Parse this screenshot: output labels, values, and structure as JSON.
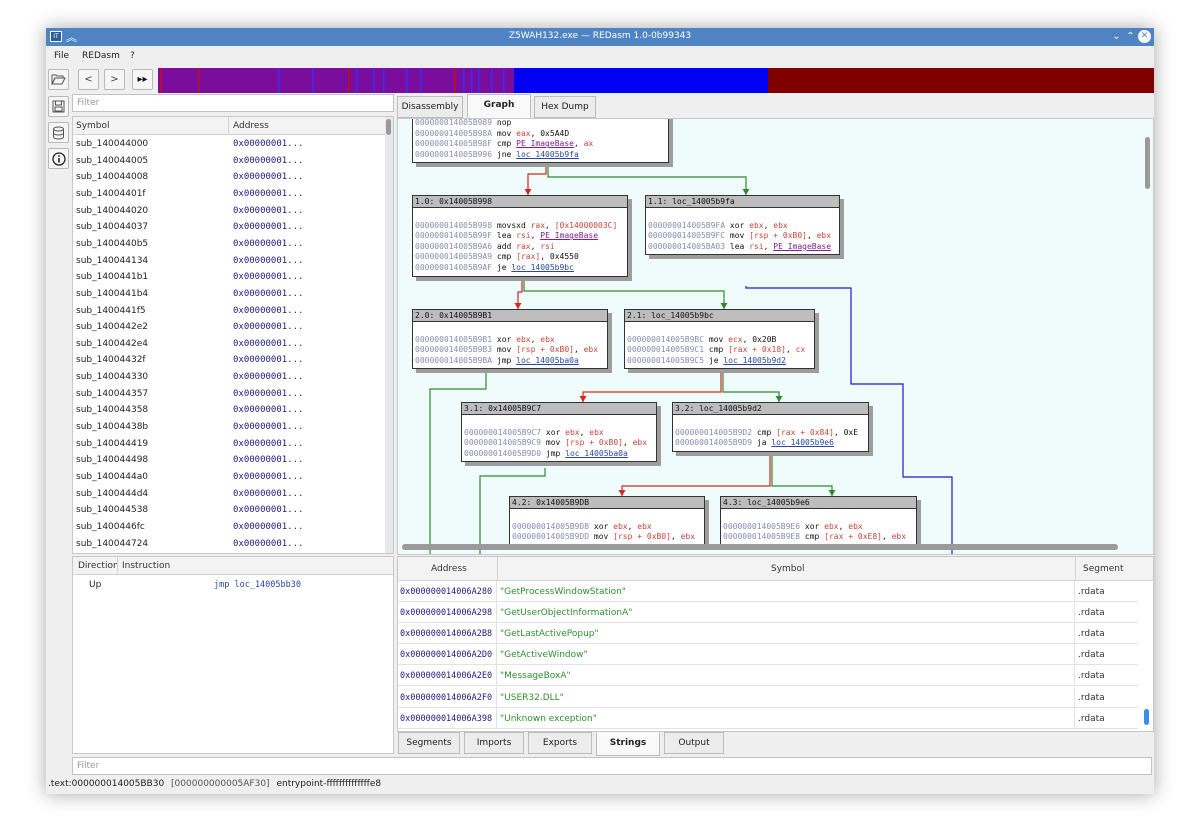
{
  "window": {
    "title": "Z5WAH132.exe — REDasm 1.0-0b99343",
    "app_icon": "IT"
  },
  "menu": [
    "File",
    "REDasm",
    "?"
  ],
  "icons": {
    "open": "folder-open-icon",
    "back": "back-icon",
    "forward": "forward-icon",
    "goto": "fast-forward-icon",
    "save": "save-icon",
    "database": "database-icon",
    "info": "info-icon"
  },
  "colors": {
    "titlebar": "#4f84c4",
    "nav_purple": "#7a0d9c",
    "nav_blue": "#0000f5",
    "nav_darkred": "#800000",
    "edge_true": "#2e8a2e",
    "edge_false": "#d0281f",
    "edge_jump": "#1919cc",
    "graph_bg": "#f0fbfb"
  },
  "symbols": {
    "filter_placeholder": "Filter",
    "columns": [
      "Symbol",
      "Address"
    ],
    "rows": [
      {
        "name": "sub_140044000",
        "address": "0x00000001..."
      },
      {
        "name": "sub_140044005",
        "address": "0x00000001..."
      },
      {
        "name": "sub_140044008",
        "address": "0x00000001..."
      },
      {
        "name": "sub_14004401f",
        "address": "0x00000001..."
      },
      {
        "name": "sub_140044020",
        "address": "0x00000001..."
      },
      {
        "name": "sub_140044037",
        "address": "0x00000001..."
      },
      {
        "name": "sub_1400440b5",
        "address": "0x00000001..."
      },
      {
        "name": "sub_140044134",
        "address": "0x00000001..."
      },
      {
        "name": "sub_1400441b1",
        "address": "0x00000001..."
      },
      {
        "name": "sub_1400441b4",
        "address": "0x00000001..."
      },
      {
        "name": "sub_1400441f5",
        "address": "0x00000001..."
      },
      {
        "name": "sub_1400442e2",
        "address": "0x00000001..."
      },
      {
        "name": "sub_1400442e4",
        "address": "0x00000001..."
      },
      {
        "name": "sub_14004432f",
        "address": "0x00000001..."
      },
      {
        "name": "sub_140044330",
        "address": "0x00000001..."
      },
      {
        "name": "sub_140044357",
        "address": "0x00000001..."
      },
      {
        "name": "sub_140044358",
        "address": "0x00000001..."
      },
      {
        "name": "sub_14004438b",
        "address": "0x00000001..."
      },
      {
        "name": "sub_140044419",
        "address": "0x00000001..."
      },
      {
        "name": "sub_140044498",
        "address": "0x00000001..."
      },
      {
        "name": "sub_1400444a0",
        "address": "0x00000001..."
      },
      {
        "name": "sub_1400444d4",
        "address": "0x00000001..."
      },
      {
        "name": "sub_140044538",
        "address": "0x00000001..."
      },
      {
        "name": "sub_1400446fc",
        "address": "0x00000001..."
      },
      {
        "name": "sub_140044724",
        "address": "0x00000001..."
      }
    ]
  },
  "tabs": {
    "top": [
      "Disassembly",
      "Graph",
      "Hex Dump"
    ],
    "top_active": "Graph",
    "bottom": [
      "Segments",
      "Imports",
      "Exports",
      "Strings",
      "Output"
    ],
    "bottom_active": "Strings"
  },
  "graph": {
    "nodes": [
      {
        "id": "n0",
        "title": "",
        "lines": [
          [
            [
              "ad",
              "000000014005B989"
            ],
            [
              "mn",
              " nop"
            ]
          ],
          [
            [
              "ad",
              "000000014005B98A"
            ],
            [
              "mn",
              " mov "
            ],
            [
              "rg",
              "eax"
            ],
            [
              "mn",
              ", 0x5A4D"
            ]
          ],
          [
            [
              "ad",
              "000000014005B98F"
            ],
            [
              "mn",
              " cmp "
            ],
            [
              "lk",
              "PE_ImageBase"
            ],
            [
              "mn",
              ", "
            ],
            [
              "rg",
              "ax"
            ]
          ],
          [
            [
              "ad",
              "000000014005B996"
            ],
            [
              "mn",
              " jne "
            ],
            [
              "lb",
              "loc_14005b9fa"
            ]
          ]
        ]
      },
      {
        "id": "n1",
        "title": "1.0: 0x14005B998",
        "lines": [
          [],
          [
            [
              "ad",
              "000000014005B998"
            ],
            [
              "mn",
              " movsxd "
            ],
            [
              "rg",
              "rax"
            ],
            [
              "mn",
              ", "
            ],
            [
              "rg",
              "[0x14000003C]"
            ]
          ],
          [
            [
              "ad",
              "000000014005B99F"
            ],
            [
              "mn",
              " lea "
            ],
            [
              "rg",
              "rsi"
            ],
            [
              "mn",
              ", "
            ],
            [
              "lk",
              "PE_ImageBase"
            ]
          ],
          [
            [
              "ad",
              "000000014005B9A6"
            ],
            [
              "mn",
              " add "
            ],
            [
              "rg",
              "rax"
            ],
            [
              "mn",
              ", "
            ],
            [
              "rg",
              "rsi"
            ]
          ],
          [
            [
              "ad",
              "000000014005B9A9"
            ],
            [
              "mn",
              " cmp "
            ],
            [
              "rg",
              "[rax]"
            ],
            [
              "mn",
              ", 0x4550"
            ]
          ],
          [
            [
              "ad",
              "000000014005B9AF"
            ],
            [
              "mn",
              " je "
            ],
            [
              "lb",
              "loc_14005b9bc"
            ]
          ]
        ]
      },
      {
        "id": "n2",
        "title": "1.1: loc_14005b9fa",
        "lines": [
          [],
          [
            [
              "ad",
              "000000014005B9FA"
            ],
            [
              "mn",
              " xor "
            ],
            [
              "rg",
              "ebx"
            ],
            [
              "mn",
              ", "
            ],
            [
              "rg",
              "ebx"
            ]
          ],
          [
            [
              "ad",
              "000000014005B9FC"
            ],
            [
              "mn",
              " mov "
            ],
            [
              "rg",
              "[rsp + 0xB0]"
            ],
            [
              "mn",
              ", "
            ],
            [
              "rg",
              "ebx"
            ]
          ],
          [
            [
              "ad",
              "000000014005BA03"
            ],
            [
              "mn",
              " lea "
            ],
            [
              "rg",
              "rsi"
            ],
            [
              "mn",
              ", "
            ],
            [
              "lk",
              "PE_ImageBase"
            ]
          ]
        ]
      },
      {
        "id": "n3",
        "title": "2.0: 0x14005B9B1",
        "lines": [
          [],
          [
            [
              "ad",
              "000000014005B9B1"
            ],
            [
              "mn",
              " xor "
            ],
            [
              "rg",
              "ebx"
            ],
            [
              "mn",
              ", "
            ],
            [
              "rg",
              "ebx"
            ]
          ],
          [
            [
              "ad",
              "000000014005B9B3"
            ],
            [
              "mn",
              " mov "
            ],
            [
              "rg",
              "[rsp + 0xB0]"
            ],
            [
              "mn",
              ", "
            ],
            [
              "rg",
              "ebx"
            ]
          ],
          [
            [
              "ad",
              "000000014005B9BA"
            ],
            [
              "mn",
              " jmp "
            ],
            [
              "lb",
              "loc_14005ba0a"
            ]
          ]
        ]
      },
      {
        "id": "n4",
        "title": "2.1: loc_14005b9bc",
        "lines": [
          [],
          [
            [
              "ad",
              "000000014005B9BC"
            ],
            [
              "mn",
              " mov "
            ],
            [
              "rg",
              "ecx"
            ],
            [
              "mn",
              ", 0x20B"
            ]
          ],
          [
            [
              "ad",
              "000000014005B9C1"
            ],
            [
              "mn",
              " cmp "
            ],
            [
              "rg",
              "[rax + 0x18]"
            ],
            [
              "mn",
              ", "
            ],
            [
              "rg",
              "cx"
            ]
          ],
          [
            [
              "ad",
              "000000014005B9C5"
            ],
            [
              "mn",
              " je "
            ],
            [
              "lb",
              "loc_14005b9d2"
            ]
          ]
        ]
      },
      {
        "id": "n5",
        "title": "3.1: 0x14005B9C7",
        "lines": [
          [],
          [
            [
              "ad",
              "000000014005B9C7"
            ],
            [
              "mn",
              " xor "
            ],
            [
              "rg",
              "ebx"
            ],
            [
              "mn",
              ", "
            ],
            [
              "rg",
              "ebx"
            ]
          ],
          [
            [
              "ad",
              "000000014005B9C9"
            ],
            [
              "mn",
              " mov "
            ],
            [
              "rg",
              "[rsp + 0xB0]"
            ],
            [
              "mn",
              ", "
            ],
            [
              "rg",
              "ebx"
            ]
          ],
          [
            [
              "ad",
              "000000014005B9D0"
            ],
            [
              "mn",
              " jmp "
            ],
            [
              "lb",
              "loc_14005ba0a"
            ]
          ]
        ]
      },
      {
        "id": "n6",
        "title": "3.2: loc_14005b9d2",
        "lines": [
          [],
          [
            [
              "ad",
              "000000014005B9D2"
            ],
            [
              "mn",
              " cmp "
            ],
            [
              "rg",
              "[rax + 0x84]"
            ],
            [
              "mn",
              ", 0xE"
            ]
          ],
          [
            [
              "ad",
              "000000014005B9D9"
            ],
            [
              "mn",
              " ja "
            ],
            [
              "lb",
              "loc_14005b9e6"
            ]
          ]
        ]
      },
      {
        "id": "n7",
        "title": "4.2: 0x14005B9DB",
        "lines": [
          [],
          [
            [
              "ad",
              "000000014005B9DB"
            ],
            [
              "mn",
              " xor "
            ],
            [
              "rg",
              "ebx"
            ],
            [
              "mn",
              ", "
            ],
            [
              "rg",
              "ebx"
            ]
          ],
          [
            [
              "ad",
              "000000014005B9DD"
            ],
            [
              "mn",
              " mov "
            ],
            [
              "rg",
              "[rsp + 0xB0]"
            ],
            [
              "mn",
              ", "
            ],
            [
              "rg",
              "ebx"
            ]
          ]
        ]
      },
      {
        "id": "n8",
        "title": "4.3: loc_14005b9e6",
        "lines": [
          [],
          [
            [
              "ad",
              "000000014005B9E6"
            ],
            [
              "mn",
              " xor "
            ],
            [
              "rg",
              "ebx"
            ],
            [
              "mn",
              ", "
            ],
            [
              "rg",
              "ebx"
            ]
          ],
          [
            [
              "ad",
              "000000014005B9E8"
            ],
            [
              "mn",
              " cmp "
            ],
            [
              "rg",
              "[rax + 0xE8]"
            ],
            [
              "mn",
              ", "
            ],
            [
              "rg",
              "ebx"
            ]
          ]
        ]
      }
    ]
  },
  "references": {
    "columns": [
      "Direction",
      "Instruction"
    ],
    "rows": [
      {
        "direction": "Up",
        "instruction": "jmp loc_14005bb30"
      }
    ]
  },
  "strings": {
    "columns": [
      "Address",
      "Symbol",
      "Segment"
    ],
    "rows": [
      {
        "address": "0x000000014006A280",
        "symbol": "\"GetProcessWindowStation\"",
        "segment": ".rdata"
      },
      {
        "address": "0x000000014006A298",
        "symbol": "\"GetUserObjectInformationA\"",
        "segment": ".rdata"
      },
      {
        "address": "0x000000014006A2B8",
        "symbol": "\"GetLastActivePopup\"",
        "segment": ".rdata"
      },
      {
        "address": "0x000000014006A2D0",
        "symbol": "\"GetActiveWindow\"",
        "segment": ".rdata"
      },
      {
        "address": "0x000000014006A2E0",
        "symbol": "\"MessageBoxA\"",
        "segment": ".rdata"
      },
      {
        "address": "0x000000014006A2F0",
        "symbol": "\"USER32.DLL\"",
        "segment": ".rdata"
      },
      {
        "address": "0x000000014006A398",
        "symbol": "\"Unknown exception\"",
        "segment": ".rdata"
      }
    ]
  },
  "bottom_filter_placeholder": "Filter",
  "status": {
    "location": ".text:000000014005BB30",
    "offset": "[000000000005AF30]",
    "function": "entrypoint-ffffffffffffffe8"
  }
}
